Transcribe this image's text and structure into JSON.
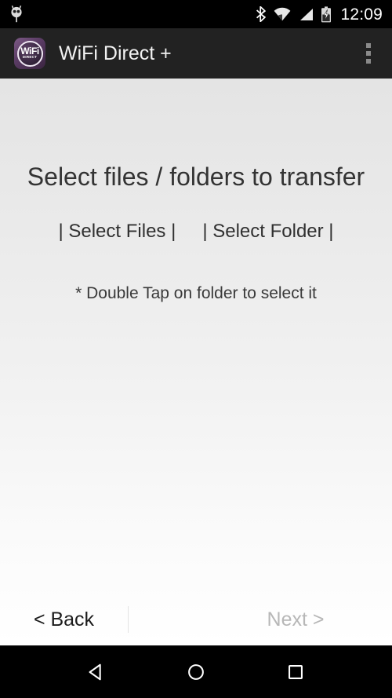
{
  "status_bar": {
    "notification_icon": "owl-notification-icon",
    "bluetooth_icon": "bluetooth-icon",
    "wifi_icon": "wifi-icon",
    "cell_signal_icon": "cell-signal-icon",
    "battery_icon": "battery-charging-icon",
    "clock": "12:09",
    "background_color": "#000000",
    "foreground_color": "#ffffff"
  },
  "app_bar": {
    "logo_name": "wifi-direct-app-logo",
    "logo_primary_text": "WiFi",
    "logo_secondary_text": "DIRECT",
    "title": "WiFi Direct +",
    "overflow_icon": "overflow-menu-icon",
    "background_color": "#222222",
    "title_color": "#f2f2f2",
    "accent_color": "#5c3d66"
  },
  "main": {
    "heading": "Select files / folders to transfer",
    "select_files_label": "| Select Files |",
    "select_folder_label": "| Select Folder |",
    "hint": "* Double Tap on folder to select it",
    "heading_color": "#333333",
    "background_top_color": "#e4e4e4",
    "background_bottom_color": "#ffffff"
  },
  "wizard_nav": {
    "back_label": "< Back",
    "next_label": "Next >",
    "back_enabled": true,
    "next_enabled": false,
    "back_color": "#1c1c1c",
    "next_color": "#b7b7b7"
  },
  "android_nav": {
    "back_icon": "nav-back-icon",
    "home_icon": "nav-home-icon",
    "recents_icon": "nav-recents-icon",
    "background_color": "#000000"
  }
}
